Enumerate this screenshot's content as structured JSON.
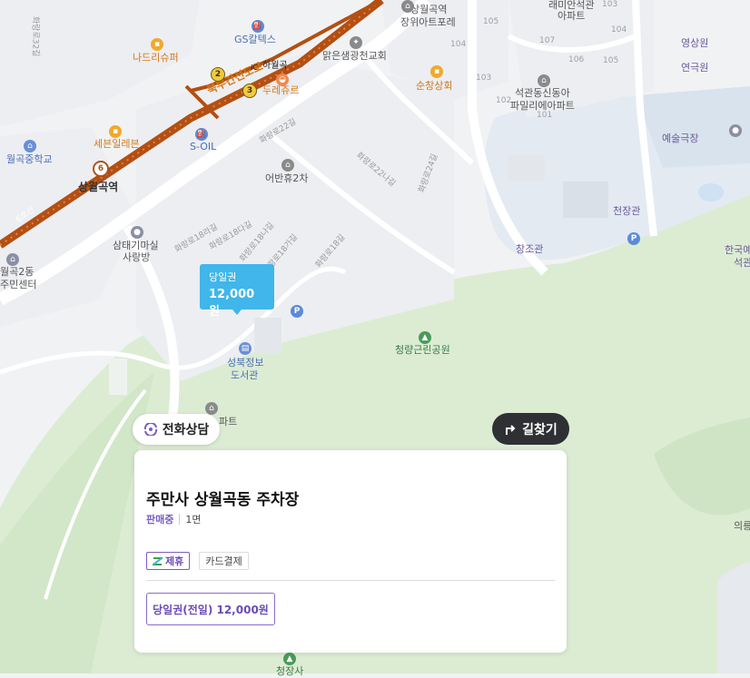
{
  "map": {
    "colors": {
      "land": "#f1f2f4",
      "park": "#dcecd3",
      "water": "#cfe1f3",
      "road": "#ffffff",
      "subway_line": "#b34f12",
      "accent": "#40b6ea",
      "brand_purple": "#7b5cc4"
    },
    "labels": {
      "shop_naduri": "나드리슈퍼",
      "gs_caltex": "GS칼텍스",
      "bukbu_road": "북부간선도로",
      "ic": "IC",
      "hawolgok": "하월곡",
      "duraejureu": "두레쥬르",
      "church": "맑은샘광천교회",
      "sundeok_market": "순창상회",
      "apt_sangwol_line1": "상월곡역",
      "apt_sangwol_line2": "장위아트포레",
      "apt_raemian_line1": "래미안석관",
      "apt_raemian_line2": "아파트",
      "apt_seokgwan_line1": "석관동신동아",
      "apt_seokgwan_line2": "파밀리에아파트",
      "yeongsang": "영상원",
      "yeongeuk": "연극원",
      "yesul_theater": "예술극장",
      "school_wolgok": "월곡중학교",
      "seboen": "세븐일레븐",
      "soil": "S-OIL",
      "station_name": "상월곡역",
      "line6": "6호선",
      "eobanhyu": "어반휴2차",
      "samtae_line1": "삼태기마실",
      "samtae_line2": "사랑방",
      "wolgok2_line1": "월곡2동",
      "wolgok2_line2": "주민센터",
      "cheonjang": "천장관",
      "changjo": "창조관",
      "hangukye_line1": "한국예",
      "hangukye_line2": "석관",
      "cheongnyang_park": "청량근린공원",
      "seongbuk_lib_line1": "성북정보",
      "seongbuk_lib_line2": "도서관",
      "apart_partial": "파트",
      "cheongjangsa": "청장사",
      "uireung": "의릉"
    },
    "roads": [
      "화랑로22길",
      "화랑로22나길",
      "화랑로24길",
      "화랑로18라길",
      "화랑로18다길",
      "화랑로18나길",
      "화랑로18가길",
      "화랑로18길",
      "화랑로32길"
    ],
    "buildings": [
      "105",
      "103",
      "104",
      "107",
      "104",
      "106",
      "105",
      "103",
      "102",
      "101"
    ],
    "stations": [
      "2",
      "3",
      "6"
    ]
  },
  "price_tag": {
    "title": "당일권",
    "price": "12,000원"
  },
  "consult_button": {
    "label": "전화상담"
  },
  "route_button": {
    "label": "길찾기"
  },
  "card": {
    "title": "주만사 상월곡동 주차장",
    "status": "판매중",
    "spaces": "1면",
    "tags": [
      "제휴",
      "카드결제"
    ],
    "ticket": "당일권(전일) 12,000원"
  }
}
